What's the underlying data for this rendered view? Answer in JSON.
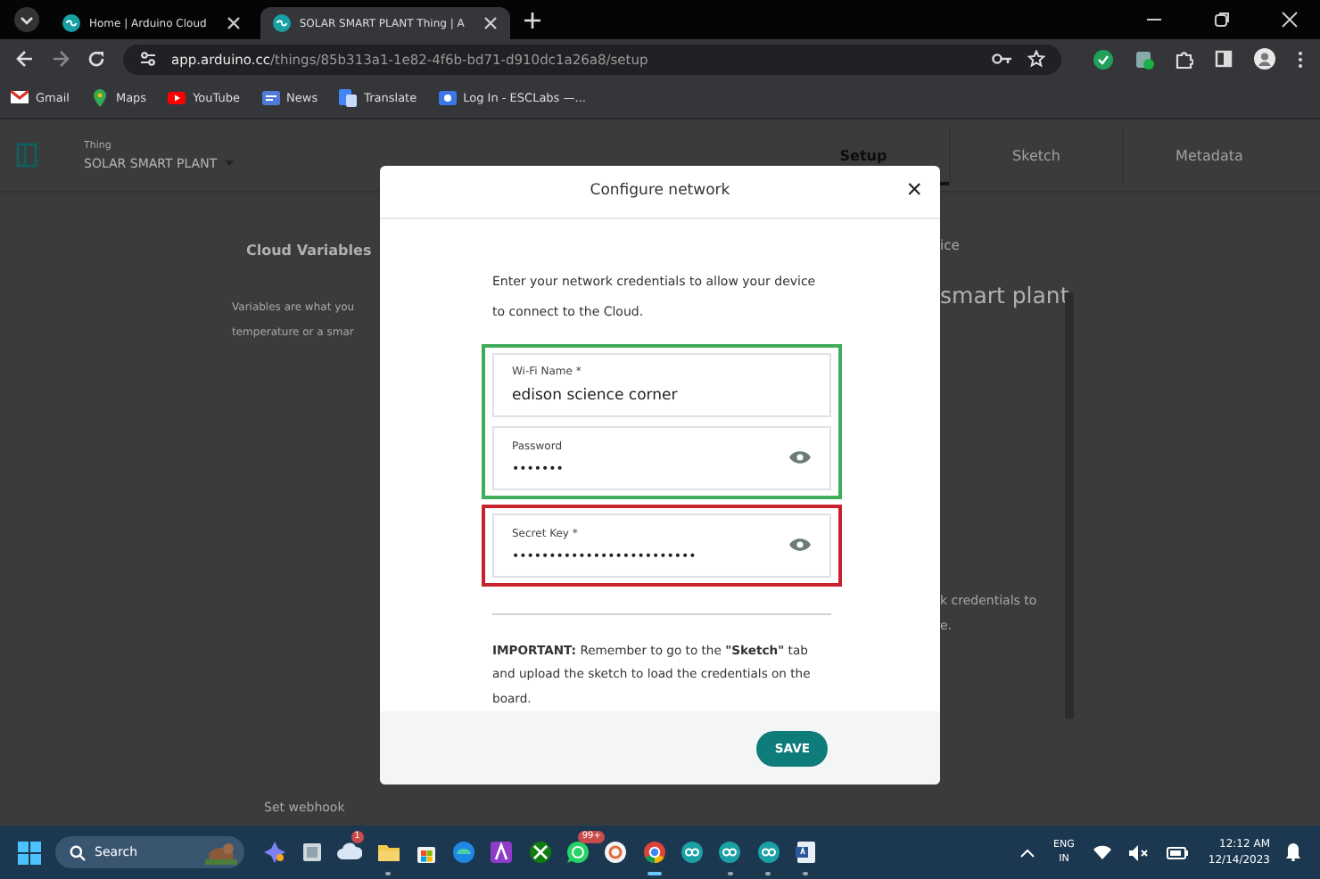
{
  "browser": {
    "tabs": [
      {
        "title": "Home | Arduino Cloud",
        "selected": false
      },
      {
        "title": "SOLAR SMART PLANT Thing | A",
        "selected": true
      }
    ],
    "url_host": "app.arduino.cc",
    "url_path": "/things/85b313a1-1e82-4f6b-bd71-d910dc1a26a8/setup",
    "bookmarks": [
      {
        "label": "Gmail",
        "kind": "mail"
      },
      {
        "label": "Maps",
        "kind": "pin"
      },
      {
        "label": "YouTube",
        "kind": "play"
      },
      {
        "label": "News",
        "kind": "news"
      },
      {
        "label": "Translate",
        "kind": "translate"
      },
      {
        "label": "Log In - ESCLabs —...",
        "kind": "page"
      }
    ]
  },
  "app": {
    "thing_label": "Thing",
    "thing_name": "SOLAR SMART PLANT",
    "tabs": [
      {
        "label": "Setup",
        "selected": true
      },
      {
        "label": "Sketch",
        "selected": false
      },
      {
        "label": "Metadata",
        "selected": false
      }
    ],
    "left": {
      "heading": "Cloud Variables",
      "lines": [
        "Variables are what you",
        "temperature or a smar"
      ],
      "footer": "Set webhook"
    },
    "right": {
      "heading": "ice",
      "title": "smart plant",
      "lines": [
        "k credentials to",
        "e."
      ]
    }
  },
  "dialog": {
    "title": "Configure network",
    "close": "×",
    "intro": "Enter your network credentials to allow your device to connect to the Cloud.",
    "groups": [
      {
        "color": "#3fae5a",
        "fields": [
          {
            "label": "Wi-Fi Name *",
            "value": "edison science corner",
            "kind": "text"
          },
          {
            "label": "Password",
            "value": "•••••••",
            "kind": "password"
          }
        ]
      },
      {
        "color": "#c8232c",
        "fields": [
          {
            "label": "Secret Key *",
            "value": "•••••••••••••••••••••••••",
            "kind": "password"
          }
        ]
      }
    ],
    "note": "**IMPORTANT:** Remember to go to the **\"Sketch\"** tab and upload the sketch to load the credentials on the board.",
    "save": "SAVE"
  },
  "taskbar": {
    "search": "Search",
    "apps": [
      {
        "kind": "sparkle",
        "open": false
      },
      {
        "kind": "square",
        "open": false
      },
      {
        "kind": "cloud",
        "open": false,
        "badge": "1"
      },
      {
        "kind": "folder",
        "open": true
      },
      {
        "kind": "bag",
        "open": false
      },
      {
        "kind": "swirl",
        "open": false
      },
      {
        "kind": "letter",
        "open": false
      },
      {
        "kind": "xbox",
        "open": false
      },
      {
        "kind": "chat",
        "open": false,
        "badge": "99+"
      },
      {
        "kind": "ring",
        "open": false
      },
      {
        "kind": "chrome",
        "open": true,
        "selected": true
      },
      {
        "kind": "infinity",
        "open": false
      },
      {
        "kind": "infinity",
        "open": true
      },
      {
        "kind": "infinity",
        "open": true
      },
      {
        "kind": "doc",
        "open": true
      }
    ],
    "language": "ENG",
    "region": "IN",
    "time": "12:12 AM",
    "date": "12/14/2023"
  }
}
